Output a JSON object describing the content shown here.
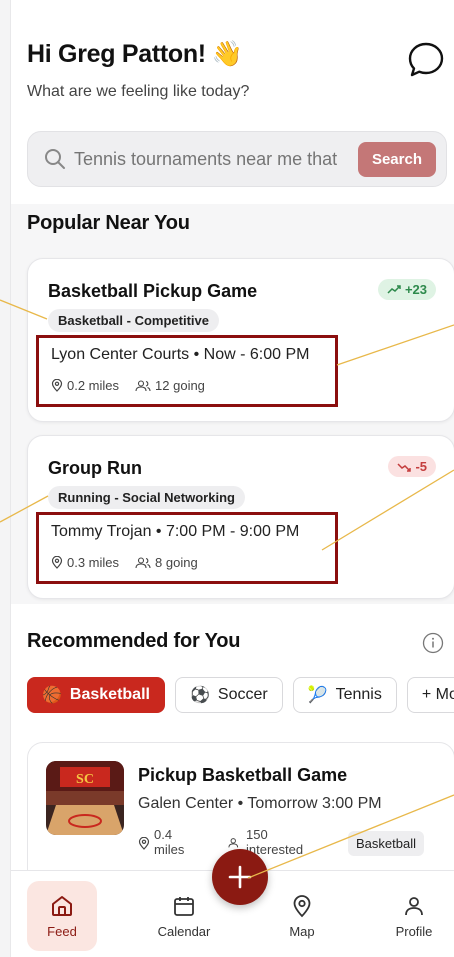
{
  "header": {
    "greeting": "Hi Greg Patton!",
    "wave_emoji": "👋",
    "subtitle": "What are we feeling like today?"
  },
  "search": {
    "placeholder": "Tennis tournaments near me that",
    "button_label": "Search"
  },
  "popular": {
    "title": "Popular Near You",
    "cards": [
      {
        "title": "Basketball Pickup Game",
        "tag": "Basketball - Competitive",
        "trend": "+23",
        "trend_dir": "up",
        "location_time": "Lyon Center Courts • Now - 6:00 PM",
        "distance": "0.2 miles",
        "going": "12 going"
      },
      {
        "title": "Group Run",
        "tag": "Running - Social Networking",
        "trend": "-5",
        "trend_dir": "down",
        "location_time": "Tommy Trojan • 7:00 PM - 9:00 PM",
        "distance": "0.3 miles",
        "going": "8 going"
      }
    ]
  },
  "recommended": {
    "title": "Recommended for You",
    "chips": [
      {
        "label": "Basketball",
        "icon": "🏀",
        "active": true
      },
      {
        "label": "Soccer",
        "icon": "⚽",
        "active": false
      },
      {
        "label": "Tennis",
        "icon": "🎾",
        "active": false
      },
      {
        "label": "+ More",
        "icon": "",
        "active": false
      }
    ],
    "card": {
      "title": "Pickup Basketball Game",
      "subtitle": "Galen Center • Tomorrow 3:00 PM",
      "distance_line1": "0.4",
      "distance_line2": "miles",
      "interested_line1": "150",
      "interested_line2": "interested",
      "tag": "Basketball"
    }
  },
  "nav": {
    "items": [
      {
        "label": "Feed",
        "icon": "home-icon"
      },
      {
        "label": "Calendar",
        "icon": "calendar-icon"
      },
      {
        "label": "Map",
        "icon": "map-pin-icon"
      },
      {
        "label": "Profile",
        "icon": "user-icon"
      }
    ]
  },
  "colors": {
    "accent": "#8b1a12",
    "chip_active": "#c9281e",
    "search_button": "#c47777",
    "annotation_box": "#8b0e0e",
    "annotation_line": "#e8b84a"
  }
}
